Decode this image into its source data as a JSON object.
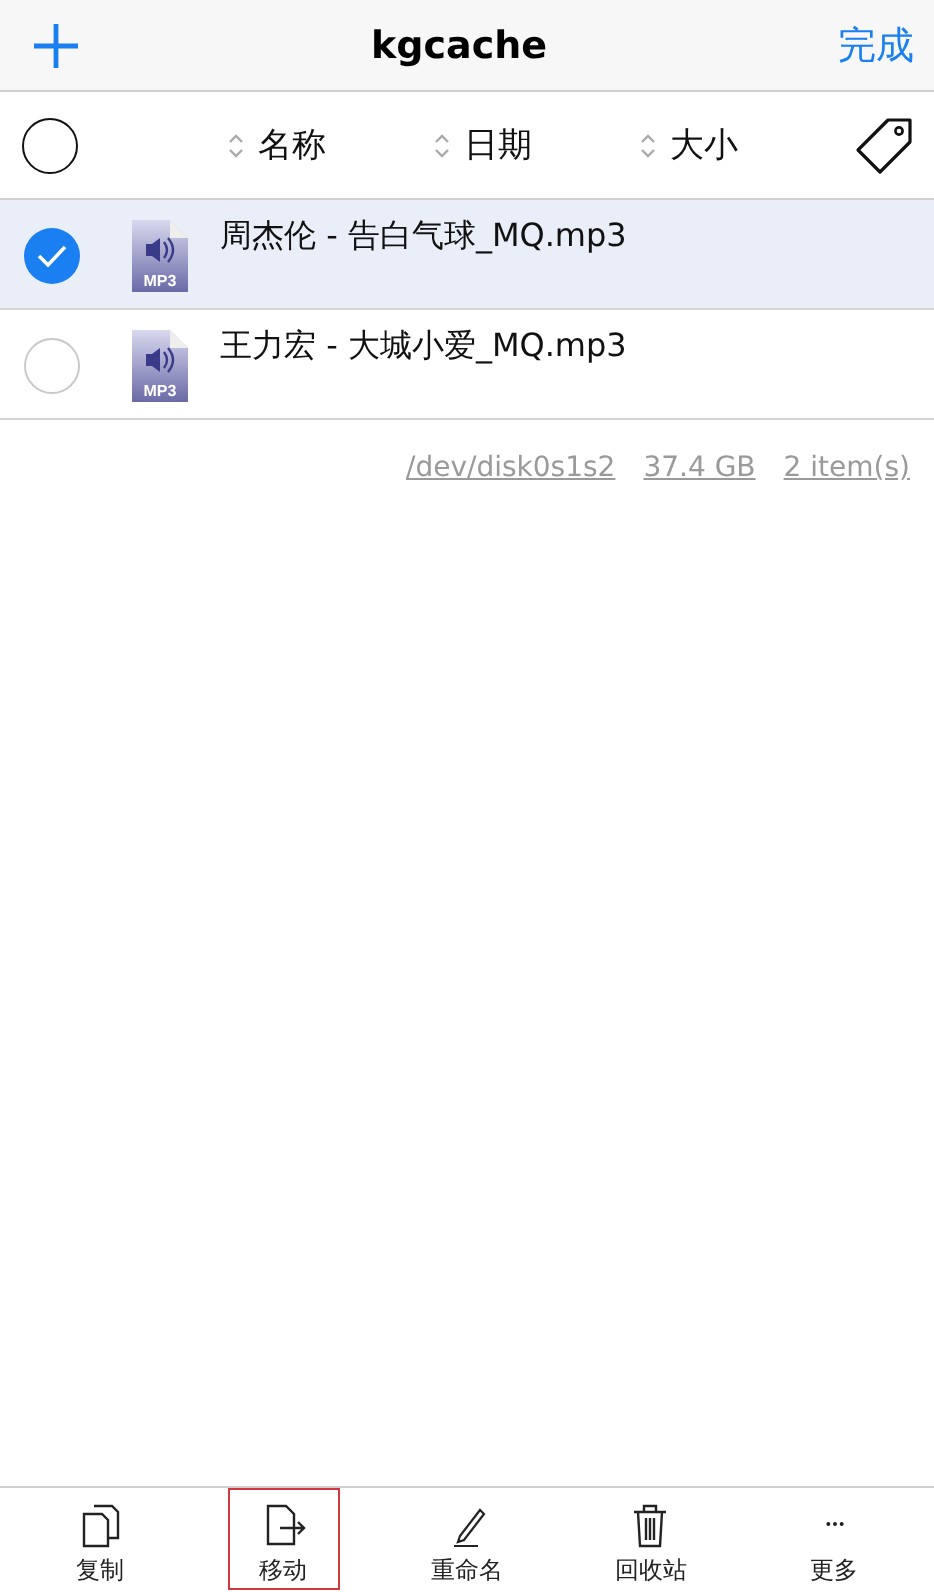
{
  "nav": {
    "title": "kgcache",
    "done": "完成"
  },
  "header": {
    "all_selected": false,
    "sort_columns": [
      {
        "label": "名称"
      },
      {
        "label": "日期"
      },
      {
        "label": "大小"
      }
    ]
  },
  "files": [
    {
      "name": "周杰伦 - 告白气球_MQ.mp3",
      "badge": "MP3",
      "selected": true
    },
    {
      "name": "王力宏 - 大城小爱_MQ.mp3",
      "badge": "MP3",
      "selected": false
    }
  ],
  "info": {
    "device": "/dev/disk0s1s2",
    "size": "37.4 GB",
    "count": "2 item(s)"
  },
  "toolbar": [
    {
      "kind": "copy",
      "label": "复制",
      "highlighted": false
    },
    {
      "kind": "move",
      "label": "移动",
      "highlighted": true
    },
    {
      "kind": "rename",
      "label": "重命名",
      "highlighted": false
    },
    {
      "kind": "trash",
      "label": "回收站",
      "highlighted": false
    },
    {
      "kind": "more",
      "label": "更多",
      "highlighted": false
    }
  ]
}
